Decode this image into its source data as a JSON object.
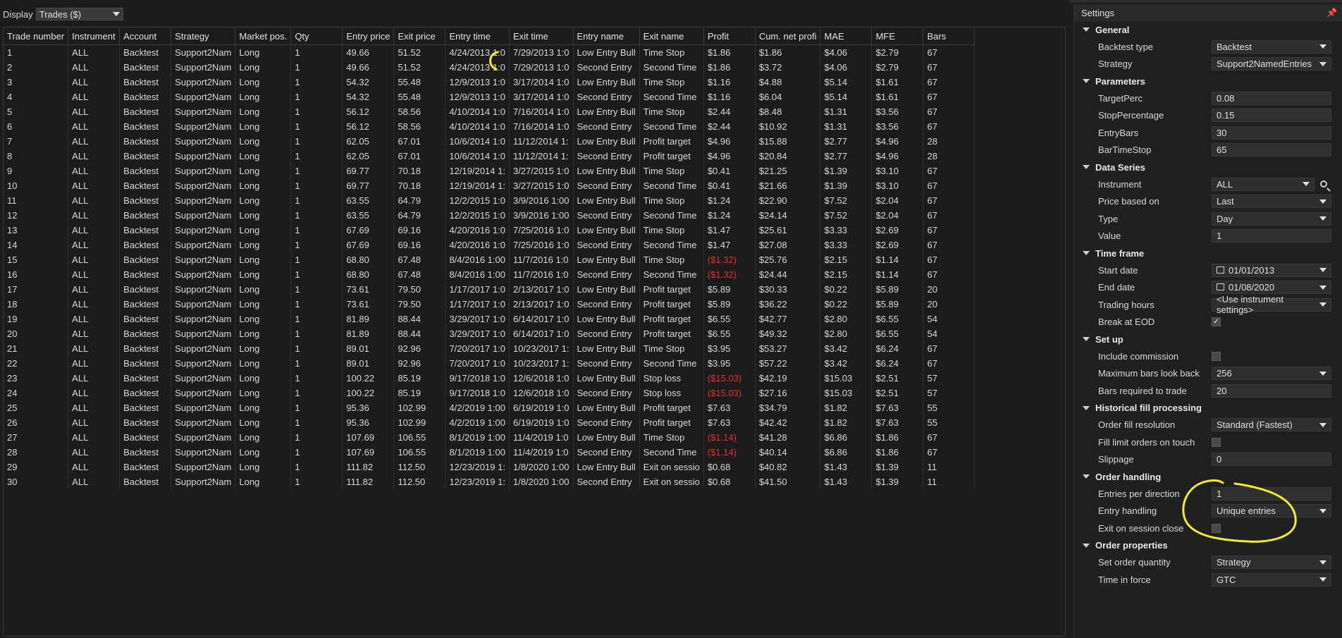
{
  "display": {
    "label": "Display",
    "value": "Trades ($)"
  },
  "grid": {
    "columns": [
      "Trade number",
      "Instrument",
      "Account",
      "Strategy",
      "Market pos.",
      "Qty",
      "Entry price",
      "Exit price",
      "Entry time",
      "Exit time",
      "Entry name",
      "Exit name",
      "Profit",
      "Cum. net profi",
      "MAE",
      "MFE",
      "Bars"
    ],
    "rows": [
      [
        "1",
        "ALL",
        "Backtest",
        "Support2Nam",
        "Long",
        "1",
        "49.66",
        "51.52",
        "4/24/2013 1:0",
        "7/29/2013 1:0",
        "Low Entry Bull",
        "Time Stop",
        "$1.86",
        "$1.86",
        "$4.06",
        "$2.79",
        "67"
      ],
      [
        "2",
        "ALL",
        "Backtest",
        "Support2Nam",
        "Long",
        "1",
        "49.66",
        "51.52",
        "4/24/2013 1:0",
        "7/29/2013 1:0",
        "Second Entry",
        "Second Time",
        "$1.86",
        "$3.72",
        "$4.06",
        "$2.79",
        "67"
      ],
      [
        "3",
        "ALL",
        "Backtest",
        "Support2Nam",
        "Long",
        "1",
        "54.32",
        "55.48",
        "12/9/2013 1:0",
        "3/17/2014 1:0",
        "Low Entry Bull",
        "Time Stop",
        "$1.16",
        "$4.88",
        "$5.14",
        "$1.61",
        "67"
      ],
      [
        "4",
        "ALL",
        "Backtest",
        "Support2Nam",
        "Long",
        "1",
        "54.32",
        "55.48",
        "12/9/2013 1:0",
        "3/17/2014 1:0",
        "Second Entry",
        "Second Time",
        "$1.16",
        "$6.04",
        "$5.14",
        "$1.61",
        "67"
      ],
      [
        "5",
        "ALL",
        "Backtest",
        "Support2Nam",
        "Long",
        "1",
        "56.12",
        "58.56",
        "4/10/2014 1:0",
        "7/16/2014 1:0",
        "Low Entry Bull",
        "Time Stop",
        "$2.44",
        "$8.48",
        "$1.31",
        "$3.56",
        "67"
      ],
      [
        "6",
        "ALL",
        "Backtest",
        "Support2Nam",
        "Long",
        "1",
        "56.12",
        "58.56",
        "4/10/2014 1:0",
        "7/16/2014 1:0",
        "Second Entry",
        "Second Time",
        "$2.44",
        "$10.92",
        "$1.31",
        "$3.56",
        "67"
      ],
      [
        "7",
        "ALL",
        "Backtest",
        "Support2Nam",
        "Long",
        "1",
        "62.05",
        "67.01",
        "10/6/2014 1:0",
        "11/12/2014 1:",
        "Low Entry Bull",
        "Profit target",
        "$4.96",
        "$15.88",
        "$2.77",
        "$4.96",
        "28"
      ],
      [
        "8",
        "ALL",
        "Backtest",
        "Support2Nam",
        "Long",
        "1",
        "62.05",
        "67.01",
        "10/6/2014 1:0",
        "11/12/2014 1:",
        "Second Entry",
        "Profit target",
        "$4.96",
        "$20.84",
        "$2.77",
        "$4.96",
        "28"
      ],
      [
        "9",
        "ALL",
        "Backtest",
        "Support2Nam",
        "Long",
        "1",
        "69.77",
        "70.18",
        "12/19/2014 1:",
        "3/27/2015 1:0",
        "Low Entry Bull",
        "Time Stop",
        "$0.41",
        "$21.25",
        "$1.39",
        "$3.10",
        "67"
      ],
      [
        "10",
        "ALL",
        "Backtest",
        "Support2Nam",
        "Long",
        "1",
        "69.77",
        "70.18",
        "12/19/2014 1:",
        "3/27/2015 1:0",
        "Second Entry",
        "Second Time",
        "$0.41",
        "$21.66",
        "$1.39",
        "$3.10",
        "67"
      ],
      [
        "11",
        "ALL",
        "Backtest",
        "Support2Nam",
        "Long",
        "1",
        "63.55",
        "64.79",
        "12/2/2015 1:0",
        "3/9/2016 1:00",
        "Low Entry Bull",
        "Time Stop",
        "$1.24",
        "$22.90",
        "$7.52",
        "$2.04",
        "67"
      ],
      [
        "12",
        "ALL",
        "Backtest",
        "Support2Nam",
        "Long",
        "1",
        "63.55",
        "64.79",
        "12/2/2015 1:0",
        "3/9/2016 1:00",
        "Second Entry",
        "Second Time",
        "$1.24",
        "$24.14",
        "$7.52",
        "$2.04",
        "67"
      ],
      [
        "13",
        "ALL",
        "Backtest",
        "Support2Nam",
        "Long",
        "1",
        "67.69",
        "69.16",
        "4/20/2016 1:0",
        "7/25/2016 1:0",
        "Low Entry Bull",
        "Time Stop",
        "$1.47",
        "$25.61",
        "$3.33",
        "$2.69",
        "67"
      ],
      [
        "14",
        "ALL",
        "Backtest",
        "Support2Nam",
        "Long",
        "1",
        "67.69",
        "69.16",
        "4/20/2016 1:0",
        "7/25/2016 1:0",
        "Second Entry",
        "Second Time",
        "$1.47",
        "$27.08",
        "$3.33",
        "$2.69",
        "67"
      ],
      [
        "15",
        "ALL",
        "Backtest",
        "Support2Nam",
        "Long",
        "1",
        "68.80",
        "67.48",
        "8/4/2016 1:00",
        "11/7/2016 1:0",
        "Low Entry Bull",
        "Time Stop",
        "($1.32)",
        "$25.76",
        "$2.15",
        "$1.14",
        "67"
      ],
      [
        "16",
        "ALL",
        "Backtest",
        "Support2Nam",
        "Long",
        "1",
        "68.80",
        "67.48",
        "8/4/2016 1:00",
        "11/7/2016 1:0",
        "Second Entry",
        "Second Time",
        "($1.32)",
        "$24.44",
        "$2.15",
        "$1.14",
        "67"
      ],
      [
        "17",
        "ALL",
        "Backtest",
        "Support2Nam",
        "Long",
        "1",
        "73.61",
        "79.50",
        "1/17/2017 1:0",
        "2/13/2017 1:0",
        "Low Entry Bull",
        "Profit target",
        "$5.89",
        "$30.33",
        "$0.22",
        "$5.89",
        "20"
      ],
      [
        "18",
        "ALL",
        "Backtest",
        "Support2Nam",
        "Long",
        "1",
        "73.61",
        "79.50",
        "1/17/2017 1:0",
        "2/13/2017 1:0",
        "Second Entry",
        "Profit target",
        "$5.89",
        "$36.22",
        "$0.22",
        "$5.89",
        "20"
      ],
      [
        "19",
        "ALL",
        "Backtest",
        "Support2Nam",
        "Long",
        "1",
        "81.89",
        "88.44",
        "3/29/2017 1:0",
        "6/14/2017 1:0",
        "Low Entry Bull",
        "Profit target",
        "$6.55",
        "$42.77",
        "$2.80",
        "$6.55",
        "54"
      ],
      [
        "20",
        "ALL",
        "Backtest",
        "Support2Nam",
        "Long",
        "1",
        "81.89",
        "88.44",
        "3/29/2017 1:0",
        "6/14/2017 1:0",
        "Second Entry",
        "Profit target",
        "$6.55",
        "$49.32",
        "$2.80",
        "$6.55",
        "54"
      ],
      [
        "21",
        "ALL",
        "Backtest",
        "Support2Nam",
        "Long",
        "1",
        "89.01",
        "92.96",
        "7/20/2017 1:0",
        "10/23/2017 1:",
        "Low Entry Bull",
        "Time Stop",
        "$3.95",
        "$53.27",
        "$3.42",
        "$6.24",
        "67"
      ],
      [
        "22",
        "ALL",
        "Backtest",
        "Support2Nam",
        "Long",
        "1",
        "89.01",
        "92.96",
        "7/20/2017 1:0",
        "10/23/2017 1:",
        "Second Entry",
        "Second Time",
        "$3.95",
        "$57.22",
        "$3.42",
        "$6.24",
        "67"
      ],
      [
        "23",
        "ALL",
        "Backtest",
        "Support2Nam",
        "Long",
        "1",
        "100.22",
        "85.19",
        "9/17/2018 1:0",
        "12/6/2018 1:0",
        "Low Entry Bull",
        "Stop loss",
        "($15.03)",
        "$42.19",
        "$15.03",
        "$2.51",
        "57"
      ],
      [
        "24",
        "ALL",
        "Backtest",
        "Support2Nam",
        "Long",
        "1",
        "100.22",
        "85.19",
        "9/17/2018 1:0",
        "12/6/2018 1:0",
        "Second Entry",
        "Stop loss",
        "($15.03)",
        "$27.16",
        "$15.03",
        "$2.51",
        "57"
      ],
      [
        "25",
        "ALL",
        "Backtest",
        "Support2Nam",
        "Long",
        "1",
        "95.36",
        "102.99",
        "4/2/2019 1:00",
        "6/19/2019 1:0",
        "Low Entry Bull",
        "Profit target",
        "$7.63",
        "$34.79",
        "$1.82",
        "$7.63",
        "55"
      ],
      [
        "26",
        "ALL",
        "Backtest",
        "Support2Nam",
        "Long",
        "1",
        "95.36",
        "102.99",
        "4/2/2019 1:00",
        "6/19/2019 1:0",
        "Second Entry",
        "Profit target",
        "$7.63",
        "$42.42",
        "$1.82",
        "$7.63",
        "55"
      ],
      [
        "27",
        "ALL",
        "Backtest",
        "Support2Nam",
        "Long",
        "1",
        "107.69",
        "106.55",
        "8/1/2019 1:00",
        "11/4/2019 1:0",
        "Low Entry Bull",
        "Time Stop",
        "($1.14)",
        "$41.28",
        "$6.86",
        "$1.86",
        "67"
      ],
      [
        "28",
        "ALL",
        "Backtest",
        "Support2Nam",
        "Long",
        "1",
        "107.69",
        "106.55",
        "8/1/2019 1:00",
        "11/4/2019 1:0",
        "Second Entry",
        "Second Time",
        "($1.14)",
        "$40.14",
        "$6.86",
        "$1.86",
        "67"
      ],
      [
        "29",
        "ALL",
        "Backtest",
        "Support2Nam",
        "Long",
        "1",
        "111.82",
        "112.50",
        "12/23/2019 1:",
        "1/8/2020 1:00",
        "Low Entry Bull",
        "Exit on sessio",
        "$0.68",
        "$40.82",
        "$1.43",
        "$1.39",
        "11"
      ],
      [
        "30",
        "ALL",
        "Backtest",
        "Support2Nam",
        "Long",
        "1",
        "111.82",
        "112.50",
        "12/23/2019 1:",
        "1/8/2020 1:00",
        "Second Entry",
        "Exit on sessio",
        "$0.68",
        "$41.50",
        "$1.43",
        "$1.39",
        "11"
      ]
    ],
    "negative_color": "#e03030"
  },
  "settings": {
    "title": "Settings",
    "pin_icon": "pin-icon",
    "sections": [
      {
        "title": "General",
        "rows": [
          {
            "name": "Backtest type",
            "type": "dropdown",
            "value": "Backtest"
          },
          {
            "name": "Strategy",
            "type": "dropdown",
            "value": "Support2NamedEntries"
          }
        ]
      },
      {
        "title": "Parameters",
        "rows": [
          {
            "name": "TargetPerc",
            "type": "text",
            "value": "0.08"
          },
          {
            "name": "StopPercentage",
            "type": "text",
            "value": "0.15"
          },
          {
            "name": "EntryBars",
            "type": "text",
            "value": "30"
          },
          {
            "name": "BarTimeStop",
            "type": "text",
            "value": "65"
          }
        ]
      },
      {
        "title": "Data Series",
        "rows": [
          {
            "name": "Instrument",
            "type": "dropdown-search",
            "value": "ALL"
          },
          {
            "name": "Price based on",
            "type": "dropdown",
            "value": "Last"
          },
          {
            "name": "Type",
            "type": "dropdown",
            "value": "Day"
          },
          {
            "name": "Value",
            "type": "text",
            "value": "1"
          }
        ]
      },
      {
        "title": "Time frame",
        "rows": [
          {
            "name": "Start date",
            "type": "date",
            "value": "01/01/2013"
          },
          {
            "name": "End date",
            "type": "date",
            "value": "01/08/2020"
          },
          {
            "name": "Trading hours",
            "type": "dropdown",
            "value": "<Use instrument settings>"
          },
          {
            "name": "Break at EOD",
            "type": "checkbox",
            "checked": true
          }
        ]
      },
      {
        "title": "Set up",
        "rows": [
          {
            "name": "Include commission",
            "type": "checkbox",
            "checked": false
          },
          {
            "name": "Maximum bars look back",
            "type": "dropdown",
            "value": "256"
          },
          {
            "name": "Bars required to trade",
            "type": "text",
            "value": "20"
          }
        ]
      },
      {
        "title": "Historical fill processing",
        "rows": [
          {
            "name": "Order fill resolution",
            "type": "dropdown",
            "value": "Standard (Fastest)"
          },
          {
            "name": "Fill limit orders on touch",
            "type": "checkbox",
            "checked": false
          },
          {
            "name": "Slippage",
            "type": "text",
            "value": "0"
          }
        ]
      },
      {
        "title": "Order handling",
        "rows": [
          {
            "name": "Entries per direction",
            "type": "text",
            "value": "1"
          },
          {
            "name": "Entry handling",
            "type": "dropdown",
            "value": "Unique entries"
          },
          {
            "name": "Exit on session close",
            "type": "checkbox",
            "checked": false
          }
        ]
      },
      {
        "title": "Order properties",
        "rows": [
          {
            "name": "Set order quantity",
            "type": "dropdown",
            "value": "Strategy"
          },
          {
            "name": "Time in force",
            "type": "dropdown",
            "value": "GTC"
          }
        ]
      }
    ]
  },
  "annotation_color": "#f2ef1a"
}
